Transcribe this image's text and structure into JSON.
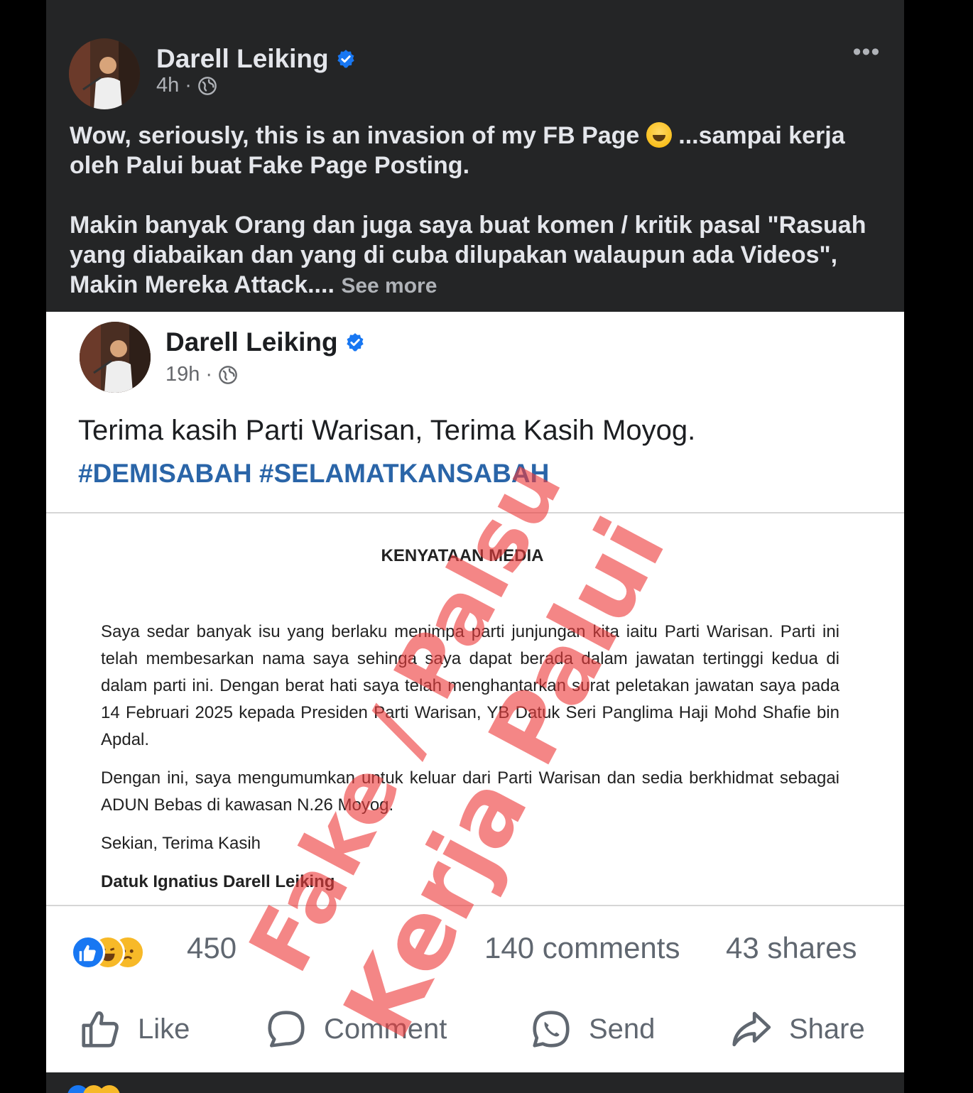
{
  "post": {
    "author": "Darell Leiking",
    "time": "4h",
    "more_label": "•••",
    "caption_p1": "Wow, seriously, this is an invasion of my FB Page",
    "caption_p1b": "...sampai kerja oleh Palui buat Fake Page Posting.",
    "caption_p2": "Makin banyak Orang dan juga saya buat komen / kritik pasal \"Rasuah yang diabaikan dan yang di cuba dilupakan walaupun ada Videos\", Makin Mereka Attack....",
    "see_more": "See more"
  },
  "shared": {
    "author": "Darell Leiking",
    "time": "19h",
    "text": "Terima kasih Parti Warisan, Terima Kasih Moyog.",
    "hashtags": "#DEMISABAH #SELAMATKANSABAH",
    "doc_title": "KENYATAAN MEDIA",
    "doc_p1": "Saya sedar banyak isu yang berlaku menimpa parti junjungan kita iaitu Parti Warisan. Parti ini telah membesarkan nama saya sehinga saya dapat berada dalam jawatan tertinggi kedua di dalam parti ini. Dengan berat hati saya telah menghantarkan surat peletakan jawatan saya pada 14 Februari 2025 kepada Presiden Parti Warisan, YB Datuk Seri Panglima Haji Mohd Shafie bin Apdal.",
    "doc_p2": "Dengan ini, saya mengumumkan untuk keluar dari Parti Warisan dan sedia berkhidmat sebagai ADUN Bebas di kawasan N.26 Moyog.",
    "doc_p3": "Sekian, Terima Kasih",
    "doc_sign": "Datuk Ignatius Darell Leiking",
    "reactions_count": "450",
    "comments": "140 comments",
    "shares": "43 shares",
    "actions": {
      "like": "Like",
      "comment": "Comment",
      "send": "Send",
      "share": "Share"
    },
    "watermark_line1": "Fake / Palsu",
    "watermark_line2": "Kerja Palui"
  },
  "colors": {
    "card_bg": "#242526",
    "text_primary_dark": "#e4e6eb",
    "text_secondary_dark": "#b0b3b8",
    "hashtag": "#2a65a8",
    "verified": "#1877f2",
    "watermark": "#ee3c3c"
  }
}
